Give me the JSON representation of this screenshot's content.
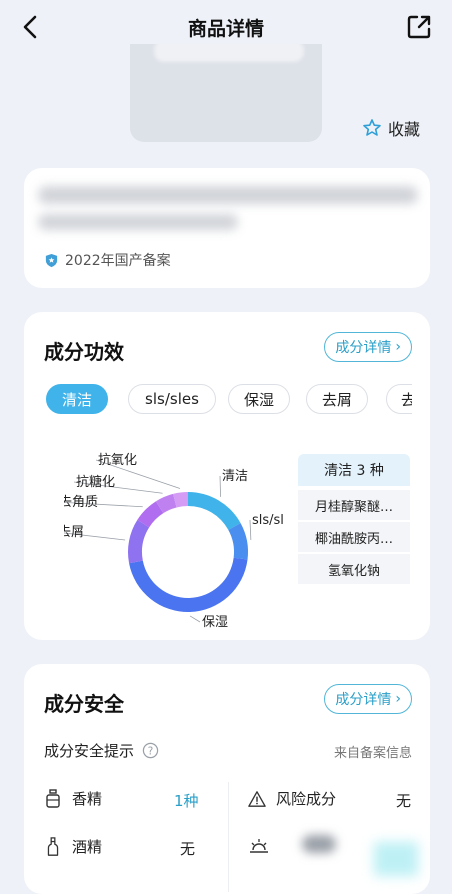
{
  "header": {
    "title": "商品详情"
  },
  "product": {
    "favorite_label": "收藏",
    "record_text": "2022年国产备案"
  },
  "efficacy": {
    "title": "成分功效",
    "detail_label": "成分详情",
    "chevron": "›",
    "tabs": [
      "清洁",
      "sls/sles",
      "保湿",
      "去屑",
      "去"
    ],
    "active_tab": 0,
    "ingredient_header": "清洁 3 种",
    "ingredients": [
      "月桂醇聚醚…",
      "椰油酰胺丙…",
      "氢氧化钠"
    ]
  },
  "chart_data": {
    "type": "pie",
    "title": "",
    "categories": [
      "清洁",
      "sls/sles",
      "保湿",
      "去屑",
      "去角质",
      "抗糖化",
      "抗氧化"
    ],
    "values": [
      17,
      10,
      45,
      12,
      7,
      5,
      4
    ],
    "colors": [
      "#3fb3ea",
      "#4a8ef0",
      "#4a74f0",
      "#8e72ef",
      "#b06df0",
      "#c081f0",
      "#d49cf5"
    ],
    "donut": true
  },
  "safety": {
    "title": "成分安全",
    "detail_label": "成分详情",
    "chevron": "›",
    "subtitle": "成分安全提示",
    "source": "来自备案信息",
    "items": [
      {
        "label": "香精",
        "value": "1种",
        "icon": "perfume-bottle-icon"
      },
      {
        "label": "风险成分",
        "value": "无",
        "icon": "warning-triangle-icon"
      },
      {
        "label": "酒精",
        "value": "无",
        "icon": "alcohol-bottle-icon"
      }
    ]
  },
  "colors": {
    "accent": "#3fb3ea",
    "accent_text": "#2a9fc8",
    "background": "#eef2f8"
  }
}
